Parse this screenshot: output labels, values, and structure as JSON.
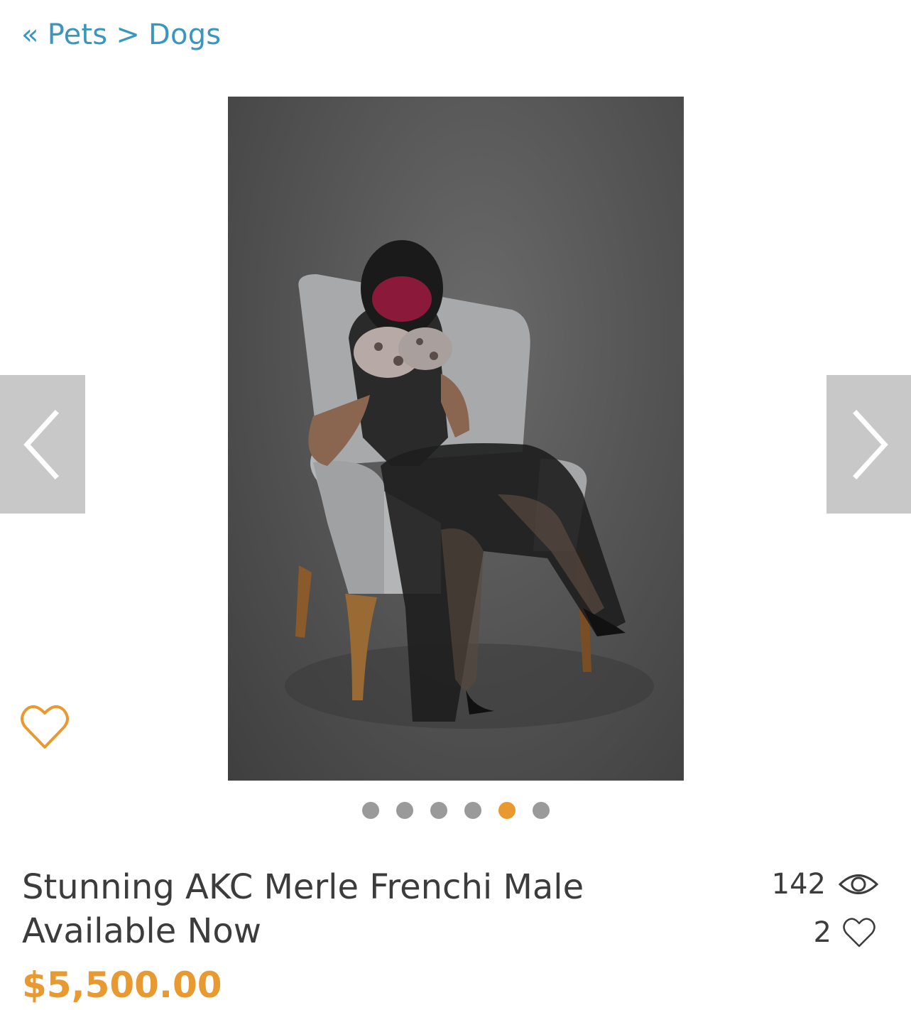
{
  "breadcrumb": {
    "back_symbol": "«",
    "parent": "Pets",
    "separator": ">",
    "current": "Dogs"
  },
  "gallery": {
    "total_images": 6,
    "active_index": 4
  },
  "listing": {
    "title": "Stunning AKC Merle Frenchi Male Available Now",
    "price": "$5,500.00",
    "views": "142",
    "likes": "2"
  },
  "icons": {
    "prev": "chevron-left-icon",
    "next": "chevron-right-icon",
    "favorite": "heart-outline-icon",
    "views": "eye-icon",
    "likes": "heart-outline-icon"
  },
  "colors": {
    "link": "#3a96bf",
    "accent": "#e8992f",
    "text": "#3c3c3c",
    "nav_bg": "#c8c8c8",
    "dot_inactive": "#9a9a9a"
  }
}
